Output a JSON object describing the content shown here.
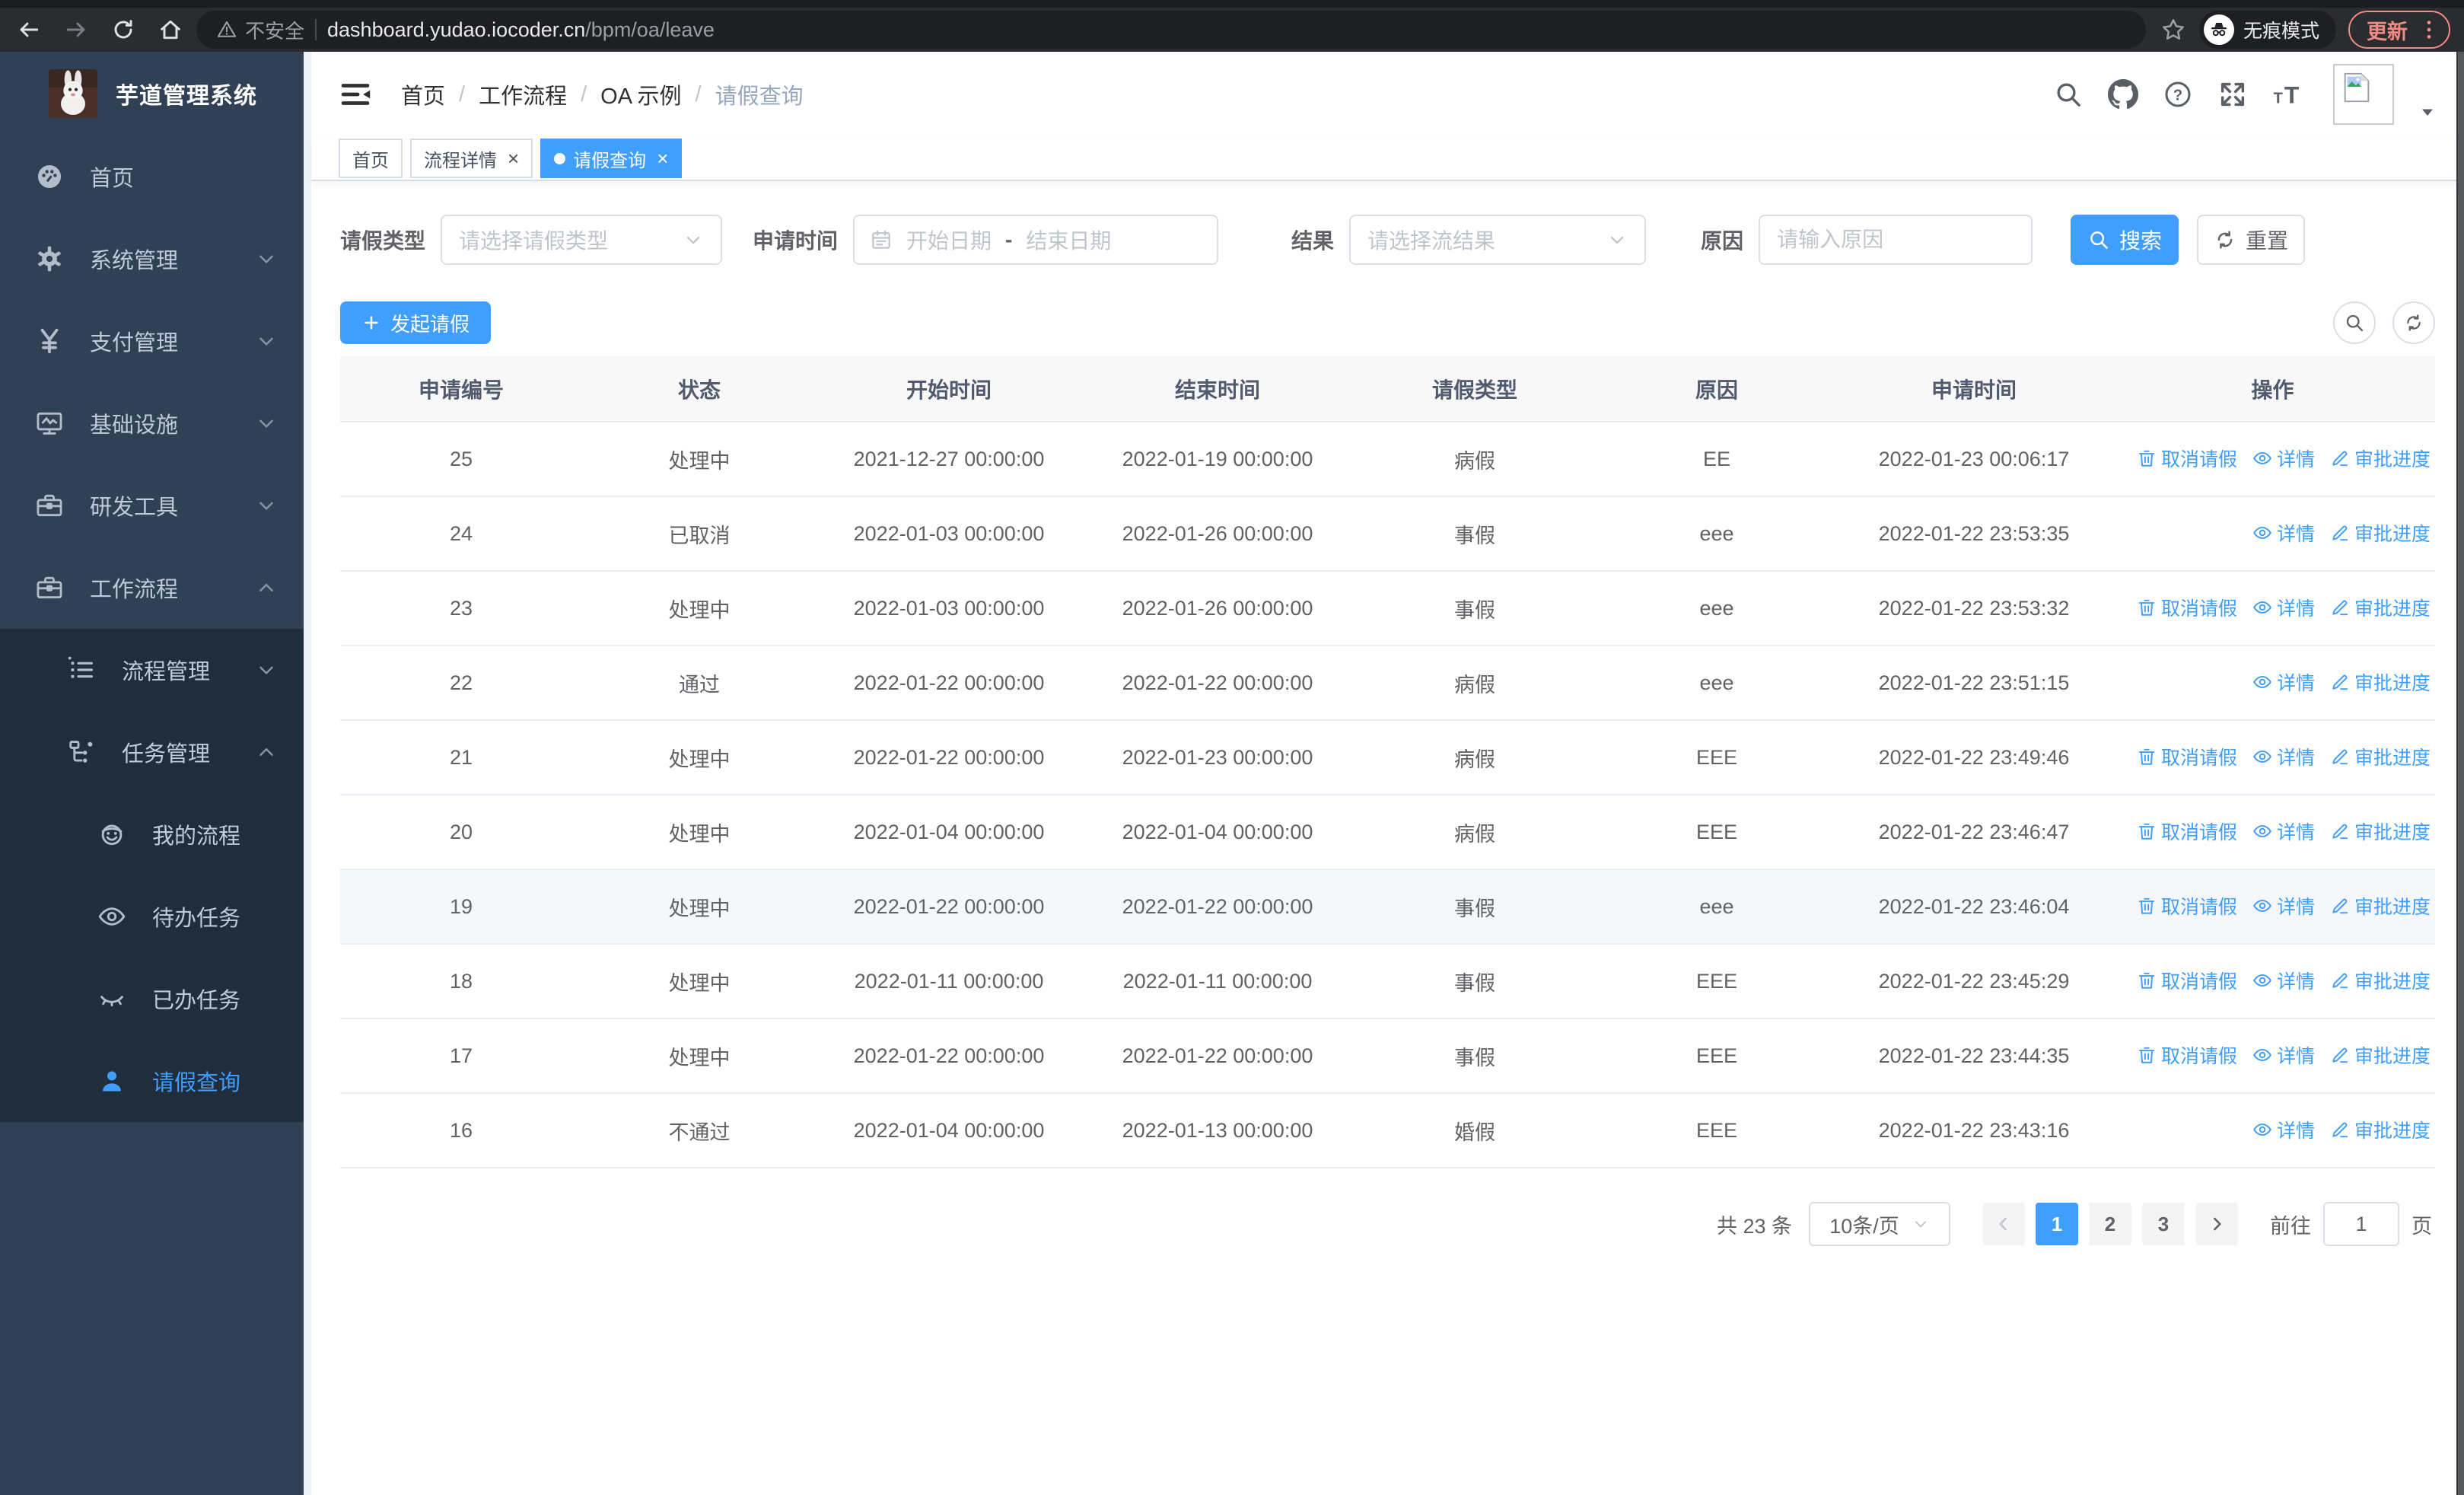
{
  "colors": {
    "primary": "#409eff",
    "sidebar_bg": "#304156",
    "submenu_bg": "#1f2d3d",
    "chrome_bg": "#2b2c30",
    "update_accent": "#f28b82",
    "table_header_bg": "#f8f8f9",
    "row_hover_bg": "#f5f7fa",
    "link_blue": "#409eff"
  },
  "browser": {
    "security_warning": "不安全",
    "url_host": "dashboard.yudao.iocoder.cn",
    "url_path": "/bpm/oa/leave",
    "incognito_label": "无痕模式",
    "update_label": "更新",
    "icons": [
      "back-icon",
      "forward-icon",
      "reload-icon",
      "home-icon",
      "warning-icon",
      "star-icon",
      "incognito-icon",
      "kebab-menu-icon"
    ]
  },
  "sidebar": {
    "app_title": "芋道管理系统",
    "logo": "rabbit-logo",
    "items": [
      {
        "key": "home",
        "label": "首页",
        "icon": "dashboard-icon",
        "level": 1,
        "chevron": null,
        "sub": false,
        "active": false
      },
      {
        "key": "system",
        "label": "系统管理",
        "icon": "gear-icon",
        "level": 1,
        "chevron": "down",
        "sub": false,
        "active": false
      },
      {
        "key": "payment",
        "label": "支付管理",
        "icon": "yen-icon",
        "level": 1,
        "chevron": "down",
        "sub": false,
        "active": false
      },
      {
        "key": "infrastructure",
        "label": "基础设施",
        "icon": "monitor-icon",
        "level": 1,
        "chevron": "down",
        "sub": false,
        "active": false
      },
      {
        "key": "dev-tools",
        "label": "研发工具",
        "icon": "toolbox-icon",
        "level": 1,
        "chevron": "down",
        "sub": false,
        "active": false
      },
      {
        "key": "workflow",
        "label": "工作流程",
        "icon": "briefcase-icon",
        "level": 1,
        "chevron": "up",
        "sub": false,
        "active": false
      },
      {
        "key": "process-mgmt",
        "label": "流程管理",
        "icon": "list-icon",
        "level": 2,
        "chevron": "down",
        "sub": true,
        "active": false
      },
      {
        "key": "task-mgmt",
        "label": "任务管理",
        "icon": "flow-icon",
        "level": 2,
        "chevron": "up",
        "sub": true,
        "active": false
      },
      {
        "key": "my-process",
        "label": "我的流程",
        "icon": "robot-icon",
        "level": 3,
        "chevron": null,
        "sub": true,
        "active": false
      },
      {
        "key": "todo-tasks",
        "label": "待办任务",
        "icon": "eye-open-icon",
        "level": 3,
        "chevron": null,
        "sub": true,
        "active": false
      },
      {
        "key": "done-tasks",
        "label": "已办任务",
        "icon": "eye-closed-icon",
        "level": 3,
        "chevron": null,
        "sub": true,
        "active": false
      },
      {
        "key": "leave-query",
        "label": "请假查询",
        "icon": "user-icon",
        "level": 3,
        "chevron": null,
        "sub": true,
        "active": true
      }
    ]
  },
  "breadcrumb": [
    "首页",
    "工作流程",
    "OA 示例",
    "请假查询"
  ],
  "navbar_icons": [
    "search-icon",
    "github-icon",
    "help-icon",
    "fullscreen-icon",
    "font-size-icon",
    "avatar",
    "caret-down-icon"
  ],
  "tabs": [
    {
      "key": "home",
      "label": "首页",
      "closable": false,
      "active": false
    },
    {
      "key": "process-detail",
      "label": "流程详情",
      "closable": true,
      "active": false
    },
    {
      "key": "leave-query",
      "label": "请假查询",
      "closable": true,
      "active": true
    }
  ],
  "filters": {
    "leave_type_label": "请假类型",
    "leave_type_placeholder": "请选择请假类型",
    "apply_time_label": "申请时间",
    "start_date_placeholder": "开始日期",
    "range_separator": "-",
    "end_date_placeholder": "结束日期",
    "result_label": "结果",
    "result_placeholder": "请选择流结果",
    "reason_label": "原因",
    "reason_placeholder": "请输入原因",
    "search_label": "搜索",
    "reset_label": "重置"
  },
  "toolbar": {
    "create_label": "发起请假"
  },
  "table": {
    "columns": [
      "申请编号",
      "状态",
      "开始时间",
      "结束时间",
      "请假类型",
      "原因",
      "申请时间",
      "操作"
    ],
    "actions_def": {
      "cancel": {
        "label": "取消请假",
        "icon": "delete-icon",
        "name": "cancel-leave-link"
      },
      "detail": {
        "label": "详情",
        "icon": "view-icon",
        "name": "detail-link"
      },
      "progress": {
        "label": "审批进度",
        "icon": "edit-icon",
        "name": "approval-progress-link"
      }
    },
    "rows": [
      {
        "id": "25",
        "status": "处理中",
        "start": "2021-12-27 00:00:00",
        "end": "2022-01-19 00:00:00",
        "type": "病假",
        "reason": "EE",
        "apply_time": "2022-01-23 00:06:17",
        "actions": [
          "cancel",
          "detail",
          "progress"
        ],
        "highlighted": false
      },
      {
        "id": "24",
        "status": "已取消",
        "start": "2022-01-03 00:00:00",
        "end": "2022-01-26 00:00:00",
        "type": "事假",
        "reason": "eee",
        "apply_time": "2022-01-22 23:53:35",
        "actions": [
          "detail",
          "progress"
        ],
        "highlighted": false
      },
      {
        "id": "23",
        "status": "处理中",
        "start": "2022-01-03 00:00:00",
        "end": "2022-01-26 00:00:00",
        "type": "事假",
        "reason": "eee",
        "apply_time": "2022-01-22 23:53:32",
        "actions": [
          "cancel",
          "detail",
          "progress"
        ],
        "highlighted": false
      },
      {
        "id": "22",
        "status": "通过",
        "start": "2022-01-22 00:00:00",
        "end": "2022-01-22 00:00:00",
        "type": "病假",
        "reason": "eee",
        "apply_time": "2022-01-22 23:51:15",
        "actions": [
          "detail",
          "progress"
        ],
        "highlighted": false
      },
      {
        "id": "21",
        "status": "处理中",
        "start": "2022-01-22 00:00:00",
        "end": "2022-01-23 00:00:00",
        "type": "病假",
        "reason": "EEE",
        "apply_time": "2022-01-22 23:49:46",
        "actions": [
          "cancel",
          "detail",
          "progress"
        ],
        "highlighted": false
      },
      {
        "id": "20",
        "status": "处理中",
        "start": "2022-01-04 00:00:00",
        "end": "2022-01-04 00:00:00",
        "type": "病假",
        "reason": "EEE",
        "apply_time": "2022-01-22 23:46:47",
        "actions": [
          "cancel",
          "detail",
          "progress"
        ],
        "highlighted": false
      },
      {
        "id": "19",
        "status": "处理中",
        "start": "2022-01-22 00:00:00",
        "end": "2022-01-22 00:00:00",
        "type": "事假",
        "reason": "eee",
        "apply_time": "2022-01-22 23:46:04",
        "actions": [
          "cancel",
          "detail",
          "progress"
        ],
        "highlighted": true
      },
      {
        "id": "18",
        "status": "处理中",
        "start": "2022-01-11 00:00:00",
        "end": "2022-01-11 00:00:00",
        "type": "事假",
        "reason": "EEE",
        "apply_time": "2022-01-22 23:45:29",
        "actions": [
          "cancel",
          "detail",
          "progress"
        ],
        "highlighted": false
      },
      {
        "id": "17",
        "status": "处理中",
        "start": "2022-01-22 00:00:00",
        "end": "2022-01-22 00:00:00",
        "type": "事假",
        "reason": "EEE",
        "apply_time": "2022-01-22 23:44:35",
        "actions": [
          "cancel",
          "detail",
          "progress"
        ],
        "highlighted": false
      },
      {
        "id": "16",
        "status": "不通过",
        "start": "2022-01-04 00:00:00",
        "end": "2022-01-13 00:00:00",
        "type": "婚假",
        "reason": "EEE",
        "apply_time": "2022-01-22 23:43:16",
        "actions": [
          "detail",
          "progress"
        ],
        "highlighted": false
      }
    ]
  },
  "pagination": {
    "total_label": "共 23 条",
    "page_size_label": "10条/页",
    "pages": [
      "1",
      "2",
      "3"
    ],
    "active_page": "1",
    "goto_label": "前往",
    "goto_value": "1",
    "unit_label": "页"
  }
}
